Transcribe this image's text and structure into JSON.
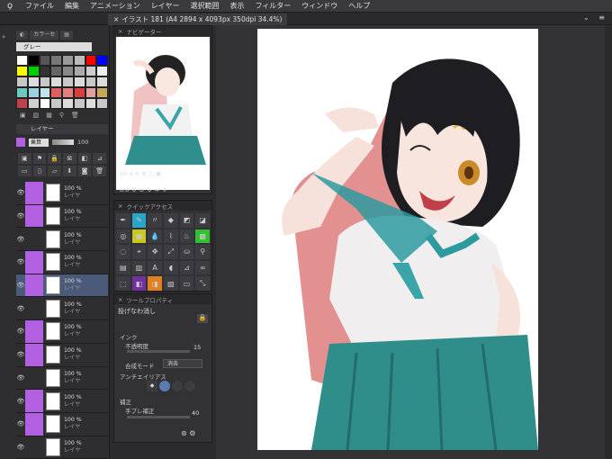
{
  "menubar": {
    "items": [
      "ファイル",
      "編集",
      "アニメーション",
      "レイヤー",
      "選択範囲",
      "表示",
      "フィルター",
      "ウィンドウ",
      "ヘルプ"
    ]
  },
  "document_tab": {
    "title": "イラスト 181 (A4 2894 x 4093px 350dpi 34.4%)"
  },
  "colorset": {
    "tab_label": "カラーセ",
    "selected": "グレー"
  },
  "layer_panel": {
    "title": "レイヤー",
    "blend_mode": "乗算",
    "opacity": "100",
    "layers": [
      {
        "opacity": "100 %",
        "name": "レイヤ",
        "paint_color": "#b060e0",
        "selected": false
      },
      {
        "opacity": "100 %",
        "name": "レイヤ",
        "paint_color": "#b060e0",
        "selected": false
      },
      {
        "opacity": "100 %",
        "name": "レイヤ",
        "paint_color": "",
        "selected": false
      },
      {
        "opacity": "100 %",
        "name": "レイヤ",
        "paint_color": "#b060e0",
        "selected": false
      },
      {
        "opacity": "100 %",
        "name": "レイヤ",
        "paint_color": "#b060e0",
        "selected": true
      },
      {
        "opacity": "100 %",
        "name": "レイヤ",
        "paint_color": "",
        "selected": false
      },
      {
        "opacity": "100 %",
        "name": "レイヤ",
        "paint_color": "#b060e0",
        "selected": false
      },
      {
        "opacity": "100 %",
        "name": "レイヤ",
        "paint_color": "#b060e0",
        "selected": false
      },
      {
        "opacity": "100 %",
        "name": "レイヤ",
        "paint_color": "",
        "selected": false
      },
      {
        "opacity": "100 %",
        "name": "レイヤ",
        "paint_color": "#b060e0",
        "selected": false
      },
      {
        "opacity": "100 %",
        "name": "レイヤ",
        "paint_color": "#b060e0",
        "selected": false
      },
      {
        "opacity": "100 %",
        "name": "レイヤ",
        "paint_color": "",
        "selected": false
      }
    ]
  },
  "navigator": {
    "title": "ナビゲーター",
    "zoom": "34.4",
    "rotation": "0.0"
  },
  "quick_access": {
    "title": "クイックアクセス"
  },
  "tool_property": {
    "title": "ツールプロパティ",
    "tool_name": "投げなわ消し",
    "ink_section": "インク",
    "opacity_label": "不透明度",
    "opacity_value": "15",
    "blend_label": "合成モード",
    "blend_value": "消去",
    "aa_label": "アンチエイリアス",
    "correction_section": "補正",
    "stabilization_label": "手ブレ補正",
    "stabilization_value": "40"
  },
  "colors": {
    "accent": "#b060e0",
    "selection": "#4a5a78",
    "panel_bg": "#323235"
  }
}
